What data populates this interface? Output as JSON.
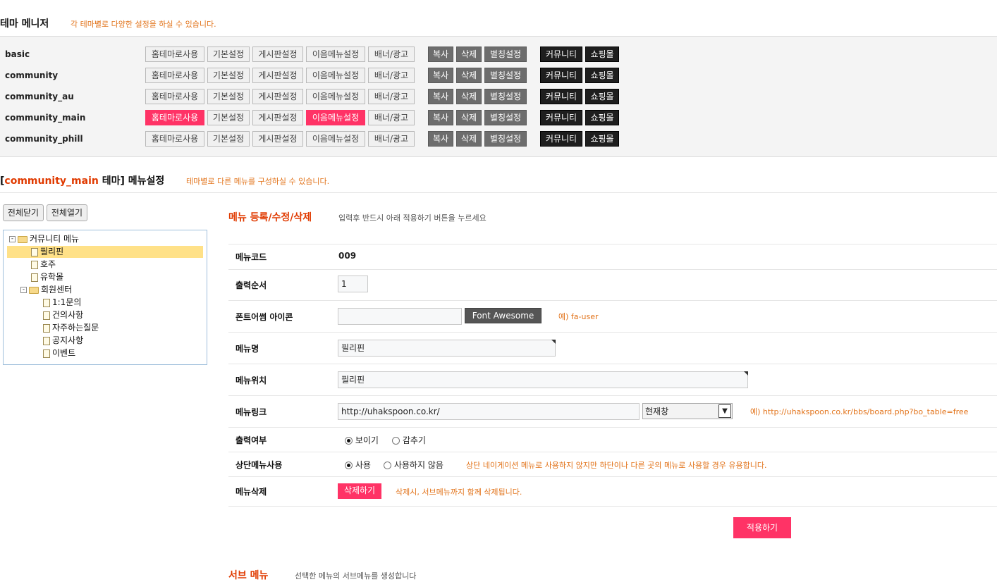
{
  "header": {
    "title": "테마 메니저",
    "subtitle": "각 테마별로 다양한 설정을 하실 수 있습니다."
  },
  "theme_buttons": {
    "home": "홈테마로사용",
    "basic": "기본설정",
    "board": "게시판설정",
    "menu": "이음메뉴설정",
    "banner": "배너/광고",
    "copy": "복사",
    "delete": "삭제",
    "alias": "별칭설정",
    "community": "커뮤니티",
    "shop": "쇼핑몰"
  },
  "themes": [
    {
      "name": "basic"
    },
    {
      "name": "community"
    },
    {
      "name": "community_au"
    },
    {
      "name": "community_main"
    },
    {
      "name": "community_phill"
    }
  ],
  "menu_section": {
    "title_prefix": "[",
    "theme_name": "community_main",
    "title_suffix": " 테마] 메뉴설정",
    "note": "테마별로 다른 메뉴를 구성하실 수 있습니다."
  },
  "tree_controls": {
    "collapse_all": "전체닫기",
    "expand_all": "전체열기"
  },
  "tree": {
    "root": "커뮤니티 메뉴",
    "items": [
      "필리핀",
      "호주",
      "유학몰"
    ],
    "group": "회원센터",
    "group_items": [
      "1:1문의",
      "건의사항",
      "자주하는질문",
      "공지사항",
      "이벤트"
    ]
  },
  "form": {
    "title": "메뉴 등록/수정/삭제",
    "hint": "입력후 반드시 아래 적용하기 버튼을 누르세요",
    "code_label": "메뉴코드",
    "code_value": "009",
    "order_label": "출력순서",
    "order_value": "1",
    "icon_label": "폰트어썸 아이콘",
    "icon_value": "",
    "icon_button": "Font Awesome",
    "icon_example": "예) fa-user",
    "name_label": "메뉴명",
    "name_value": "필리핀",
    "position_label": "메뉴위치",
    "position_value": "필리핀",
    "link_label": "메뉴링크",
    "link_value": "http://uhakspoon.co.kr/",
    "link_target": "현재창",
    "link_example": "예) http://uhakspoon.co.kr/bbs/board.php?bo_table=free",
    "visible_label": "출력여부",
    "visible_show": "보이기",
    "visible_hide": "감추기",
    "top_label": "상단메뉴사용",
    "top_use": "사용",
    "top_nouse": "사용하지 않음",
    "top_note": "상단 네이게이션 메뉴로 사용하지 않지만 하단이나 다른 곳의 메뉴로 사용할 경우 유용합니다.",
    "delete_label": "메뉴삭제",
    "delete_button": "삭제하기",
    "delete_note": "삭제시, 서브메뉴까지 함께 삭제됩니다.",
    "apply_button": "적용하기"
  },
  "submenu": {
    "title": "서브 메뉴",
    "hint": "선택한 메뉴의 서브메뉴를 생성합니다"
  }
}
